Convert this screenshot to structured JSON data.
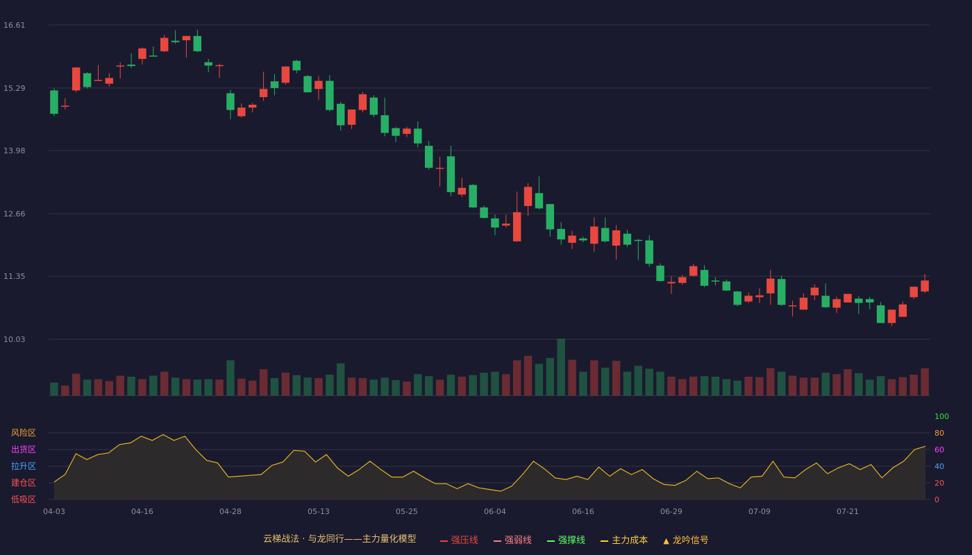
{
  "colors": {
    "background": "#1a1a2e",
    "up": "#e8483f",
    "down": "#27b065",
    "grid": "#343447",
    "indicator_line": "#e3b320"
  },
  "chart_data": [
    {
      "type": "candlestick",
      "y_ticks": [
        "16.61",
        "15.29",
        "13.98",
        "12.66",
        "11.35",
        "10.03"
      ],
      "ylim": [
        10.03,
        16.61
      ],
      "x_ticks": [
        {
          "index": 0,
          "label": "04-03"
        },
        {
          "index": 8,
          "label": "04-16"
        },
        {
          "index": 16,
          "label": "04-28"
        },
        {
          "index": 24,
          "label": "05-13"
        },
        {
          "index": 32,
          "label": "05-25"
        },
        {
          "index": 40,
          "label": "06-04"
        },
        {
          "index": 48,
          "label": "06-16"
        },
        {
          "index": 56,
          "label": "06-29"
        },
        {
          "index": 64,
          "label": "07-09"
        },
        {
          "index": 72,
          "label": "07-21"
        }
      ],
      "ohlc": [
        [
          15.24,
          15.28,
          14.7,
          14.75
        ],
        [
          14.9,
          15.08,
          14.84,
          14.92
        ],
        [
          15.24,
          15.72,
          15.2,
          15.72
        ],
        [
          15.6,
          15.62,
          15.28,
          15.31
        ],
        [
          15.45,
          15.77,
          15.44,
          15.46
        ],
        [
          15.38,
          15.6,
          15.32,
          15.5
        ],
        [
          15.75,
          15.83,
          15.49,
          15.76
        ],
        [
          15.78,
          16.02,
          15.71,
          15.75
        ],
        [
          15.9,
          16.14,
          15.78,
          16.12
        ],
        [
          15.97,
          16.16,
          15.95,
          15.96
        ],
        [
          16.06,
          16.4,
          16.04,
          16.34
        ],
        [
          16.28,
          16.5,
          16.22,
          16.25
        ],
        [
          16.29,
          16.38,
          15.93,
          16.38
        ],
        [
          16.38,
          16.51,
          16.04,
          16.06
        ],
        [
          15.83,
          15.9,
          15.62,
          15.76
        ],
        [
          15.75,
          15.8,
          15.5,
          15.77
        ],
        [
          15.18,
          15.25,
          14.64,
          14.83
        ],
        [
          14.7,
          14.97,
          14.67,
          14.88
        ],
        [
          14.88,
          14.98,
          14.78,
          14.94
        ],
        [
          15.1,
          15.63,
          15.02,
          15.27
        ],
        [
          15.43,
          15.58,
          15.14,
          15.29
        ],
        [
          15.4,
          15.75,
          15.36,
          15.74
        ],
        [
          15.86,
          15.88,
          15.6,
          15.66
        ],
        [
          15.54,
          15.56,
          15.2,
          15.2
        ],
        [
          15.27,
          15.54,
          15.04,
          15.44
        ],
        [
          15.44,
          15.56,
          14.8,
          14.83
        ],
        [
          14.96,
          15.0,
          14.4,
          14.51
        ],
        [
          14.52,
          14.83,
          14.43,
          14.84
        ],
        [
          14.83,
          15.21,
          14.78,
          15.16
        ],
        [
          15.09,
          15.14,
          14.68,
          14.73
        ],
        [
          14.72,
          15.09,
          14.28,
          14.35
        ],
        [
          14.45,
          14.47,
          14.16,
          14.29
        ],
        [
          14.33,
          14.48,
          14.26,
          14.44
        ],
        [
          14.44,
          14.59,
          14.05,
          14.13
        ],
        [
          14.08,
          14.18,
          13.58,
          13.62
        ],
        [
          13.62,
          13.85,
          13.23,
          13.62
        ],
        [
          13.86,
          14.08,
          13.03,
          13.11
        ],
        [
          13.06,
          13.41,
          13.01,
          13.2
        ],
        [
          13.26,
          13.28,
          12.78,
          12.79
        ],
        [
          12.79,
          12.83,
          12.56,
          12.57
        ],
        [
          12.56,
          12.64,
          12.21,
          12.37
        ],
        [
          12.41,
          12.64,
          12.37,
          12.45
        ],
        [
          12.08,
          13.12,
          12.07,
          12.69
        ],
        [
          12.82,
          13.3,
          12.61,
          13.22
        ],
        [
          13.09,
          13.44,
          12.75,
          12.77
        ],
        [
          12.86,
          12.86,
          12.18,
          12.33
        ],
        [
          12.34,
          12.48,
          12.01,
          12.12
        ],
        [
          12.05,
          12.3,
          11.92,
          12.2
        ],
        [
          12.14,
          12.18,
          12.06,
          12.1
        ],
        [
          12.03,
          12.58,
          11.86,
          12.39
        ],
        [
          12.36,
          12.58,
          12.06,
          12.08
        ],
        [
          11.99,
          12.42,
          11.7,
          12.31
        ],
        [
          12.24,
          12.32,
          11.96,
          12.01
        ],
        [
          12.11,
          12.13,
          11.69,
          12.1
        ],
        [
          12.1,
          12.21,
          11.55,
          11.61
        ],
        [
          11.57,
          11.62,
          11.23,
          11.25
        ],
        [
          11.2,
          11.35,
          10.98,
          11.23
        ],
        [
          11.21,
          11.38,
          11.17,
          11.33
        ],
        [
          11.36,
          11.61,
          11.34,
          11.56
        ],
        [
          11.48,
          11.58,
          11.12,
          11.15
        ],
        [
          11.26,
          11.33,
          11.16,
          11.24
        ],
        [
          11.24,
          11.28,
          11.04,
          11.05
        ],
        [
          11.03,
          11.04,
          10.72,
          10.75
        ],
        [
          10.82,
          11.0,
          10.79,
          10.94
        ],
        [
          10.91,
          11.1,
          10.79,
          10.95
        ],
        [
          10.99,
          11.48,
          10.75,
          11.3
        ],
        [
          11.29,
          11.36,
          10.73,
          10.75
        ],
        [
          10.72,
          10.84,
          10.51,
          10.74
        ],
        [
          10.65,
          10.99,
          10.65,
          10.9
        ],
        [
          10.95,
          11.18,
          10.85,
          11.11
        ],
        [
          10.94,
          11.2,
          10.69,
          10.7
        ],
        [
          10.69,
          10.92,
          10.58,
          10.87
        ],
        [
          10.8,
          10.97,
          10.8,
          10.98
        ],
        [
          10.88,
          10.93,
          10.56,
          10.79
        ],
        [
          10.87,
          10.92,
          10.66,
          10.8
        ],
        [
          10.74,
          10.81,
          10.37,
          10.37
        ],
        [
          10.37,
          10.63,
          10.31,
          10.65
        ],
        [
          10.5,
          10.82,
          10.5,
          10.76
        ],
        [
          10.91,
          11.07,
          10.87,
          11.13
        ],
        [
          11.03,
          11.4,
          11.0,
          11.26
        ]
      ],
      "volume": [
        26,
        20,
        44,
        32,
        33,
        29,
        40,
        38,
        33,
        40,
        48,
        36,
        33,
        32,
        33,
        32,
        71,
        34,
        30,
        53,
        35,
        46,
        41,
        36,
        35,
        42,
        65,
        36,
        35,
        32,
        36,
        31,
        28,
        43,
        39,
        32,
        42,
        38,
        41,
        46,
        48,
        43,
        71,
        80,
        64,
        76,
        115,
        72,
        48,
        71,
        56,
        70,
        48,
        60,
        54,
        48,
        38,
        33,
        38,
        39,
        38,
        33,
        30,
        38,
        37,
        55,
        48,
        40,
        36,
        36,
        46,
        43,
        53,
        45,
        32,
        39,
        33,
        37,
        42,
        55
      ]
    },
    {
      "type": "area",
      "ylim": [
        0,
        100
      ],
      "y_ticks": [
        "100",
        "80",
        "60",
        "40",
        "20",
        "0"
      ],
      "zones": [
        {
          "label": "风险区",
          "value": 80,
          "color": "#f0a030"
        },
        {
          "label": "出货区",
          "value": 60,
          "color": "#ff40ff"
        },
        {
          "label": "拉升区",
          "value": 40,
          "color": "#4aa0ff"
        },
        {
          "label": "建仓区",
          "value": 20,
          "color": "#ff5050"
        },
        {
          "label": "低吸区",
          "value": 0,
          "color": "#ff5050"
        }
      ],
      "tick_colors": [
        "#30e030",
        "#f0a030",
        "#ff40ff",
        "#4aa0ff",
        "#ff5050",
        "#ff5050"
      ],
      "values": [
        21,
        30,
        55,
        48,
        54,
        56,
        66,
        68,
        76,
        71,
        78,
        71,
        76,
        60,
        47,
        44,
        27,
        28,
        29,
        30,
        41,
        45,
        59,
        58,
        45,
        54,
        38,
        28,
        36,
        46,
        36,
        27,
        27,
        34,
        26,
        19,
        19,
        13,
        19,
        14,
        12,
        10,
        16,
        30,
        46,
        37,
        26,
        24,
        28,
        24,
        39,
        28,
        37,
        30,
        36,
        25,
        18,
        17,
        23,
        34,
        25,
        26,
        19,
        14,
        27,
        28,
        46,
        27,
        26,
        36,
        44,
        31,
        38,
        43,
        36,
        42,
        26,
        38,
        46,
        60,
        64
      ]
    }
  ],
  "legend": {
    "title": "云梯战法 · 与龙同行——主力量化模型",
    "items": [
      {
        "label": "强压线",
        "color": "#e8483f",
        "style": "solid"
      },
      {
        "label": "强弱线",
        "color": "#ff8080",
        "style": "dashed"
      },
      {
        "label": "强撑线",
        "color": "#60ff60",
        "style": "solid"
      },
      {
        "label": "主力成本",
        "color": "#ffd040",
        "style": "dashed"
      },
      {
        "label": "龙吟信号",
        "color": "#ffc040",
        "style": "triangle"
      }
    ]
  }
}
